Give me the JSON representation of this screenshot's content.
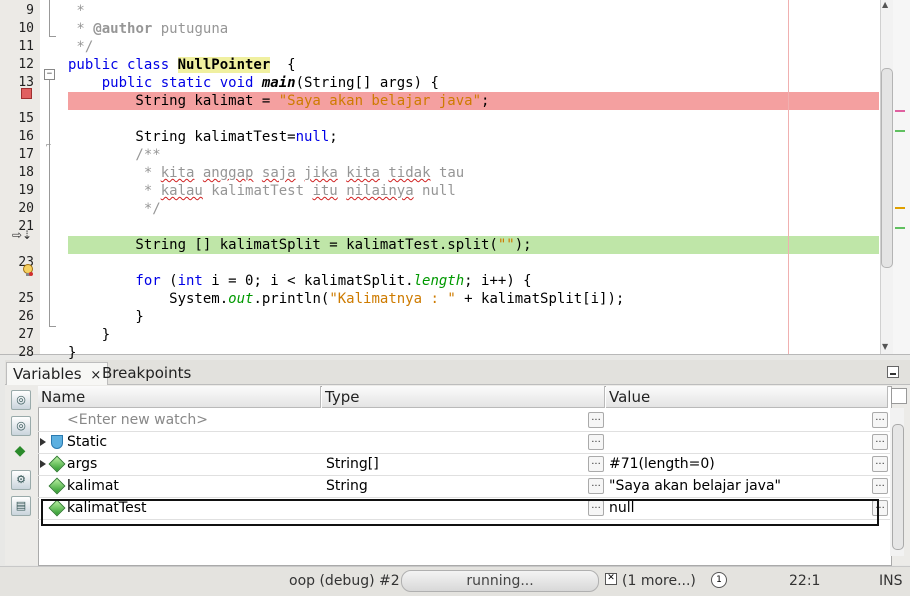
{
  "editor": {
    "lines": [
      {
        "num": "9",
        "parts": [
          [
            "cmt",
            " *"
          ]
        ]
      },
      {
        "num": "10",
        "parts": [
          [
            "cmt",
            " * "
          ],
          [
            "tag",
            "@author"
          ],
          [
            "cmt",
            " putuguna"
          ]
        ]
      },
      {
        "num": "11",
        "parts": [
          [
            "cmt",
            " */"
          ]
        ]
      },
      {
        "num": "12",
        "parts": [
          [
            "kw",
            "public class "
          ],
          [
            "hl",
            "NullPointer"
          ],
          [
            "",
            "  {"
          ]
        ]
      },
      {
        "num": "13",
        "parts": [
          [
            "kw",
            "    public static void "
          ],
          [
            "fn",
            "main"
          ],
          [
            "",
            "(String[] args) {"
          ]
        ]
      },
      {
        "num": "",
        "bg": "red",
        "parts": [
          [
            "",
            "        String kalimat = "
          ],
          [
            "str",
            "\"Saya akan belajar java\""
          ],
          [
            "",
            ";"
          ]
        ]
      },
      {
        "num": "15",
        "parts": [
          [
            "",
            ""
          ]
        ]
      },
      {
        "num": "16",
        "parts": [
          [
            "",
            "        String kalimatTest="
          ],
          [
            "kw",
            "null"
          ],
          [
            "",
            ";"
          ]
        ]
      },
      {
        "num": "17",
        "parts": [
          [
            "cmt",
            "        /**"
          ]
        ]
      },
      {
        "num": "18",
        "parts": [
          [
            "cmt",
            "         * "
          ],
          [
            "sq",
            "kita"
          ],
          [
            "cmt",
            " "
          ],
          [
            "sq",
            "anggap"
          ],
          [
            "cmt",
            " "
          ],
          [
            "sq",
            "saja"
          ],
          [
            "cmt",
            " "
          ],
          [
            "sq",
            "jika"
          ],
          [
            "cmt",
            " "
          ],
          [
            "sq",
            "kita"
          ],
          [
            "cmt",
            " "
          ],
          [
            "sq",
            "tidak"
          ],
          [
            "cmt",
            " tau"
          ]
        ]
      },
      {
        "num": "19",
        "parts": [
          [
            "cmt",
            "         * "
          ],
          [
            "sq",
            "kalau"
          ],
          [
            "cmt",
            " kalimatTest "
          ],
          [
            "sq",
            "itu"
          ],
          [
            "cmt",
            " "
          ],
          [
            "sq",
            "nilainya"
          ],
          [
            "cmt",
            " null"
          ]
        ]
      },
      {
        "num": "20",
        "parts": [
          [
            "cmt",
            "         */"
          ]
        ]
      },
      {
        "num": "21",
        "parts": [
          [
            "",
            ""
          ]
        ]
      },
      {
        "num": "",
        "bg": "green",
        "parts": [
          [
            "",
            "        String [] kalimatSplit = kalimatTest.split("
          ],
          [
            "str",
            "\"\""
          ],
          [
            "",
            ");"
          ]
        ]
      },
      {
        "num": "23",
        "parts": [
          [
            "",
            ""
          ]
        ]
      },
      {
        "num": "",
        "parts": [
          [
            "kw",
            "        for"
          ],
          [
            "",
            " ("
          ],
          [
            "kw",
            "int"
          ],
          [
            "",
            " i = 0; i < kalimatSplit."
          ],
          [
            "fld",
            "length"
          ],
          [
            "",
            "; i++) {"
          ]
        ]
      },
      {
        "num": "25",
        "parts": [
          [
            "",
            "            System."
          ],
          [
            "fld",
            "out"
          ],
          [
            "",
            ".println("
          ],
          [
            "str",
            "\"Kalimatnya : \""
          ],
          [
            "",
            " + kalimatSplit[i]);"
          ]
        ]
      },
      {
        "num": "26",
        "parts": [
          [
            "",
            "        }"
          ]
        ]
      },
      {
        "num": "27",
        "parts": [
          [
            "",
            "    }"
          ]
        ]
      },
      {
        "num": "28",
        "parts": [
          [
            "",
            "}"
          ]
        ]
      }
    ]
  },
  "debug": {
    "tabs": [
      "Variables",
      "Breakpoints"
    ],
    "close_glyph": "×",
    "columns": [
      "Name",
      "Type",
      "Value"
    ],
    "rows": [
      {
        "name": "<Enter new watch>",
        "type": "",
        "value": "",
        "icon": "none",
        "expand": false
      },
      {
        "name": "Static",
        "type": "",
        "value": "",
        "icon": "shield",
        "expand": true
      },
      {
        "name": "args",
        "type": "String[]",
        "value": "#71(length=0)",
        "icon": "diamond",
        "expand": true
      },
      {
        "name": "kalimat",
        "type": "String",
        "value": "\"Saya akan belajar java\"",
        "icon": "diamond",
        "expand": false
      },
      {
        "name": "kalimatTest",
        "type": "",
        "value": "null",
        "icon": "diamond",
        "expand": false
      }
    ],
    "ellipsis": "...",
    "toolbar_icons": [
      "watch-icon",
      "new-watch-icon",
      "add-watch-icon",
      "settings-icon",
      "export-icon"
    ]
  },
  "status": {
    "session": "oop (debug) #2",
    "progress": "running...",
    "more": "(1 more...)",
    "notifications": "1",
    "position": "22:1",
    "mode": "INS"
  }
}
